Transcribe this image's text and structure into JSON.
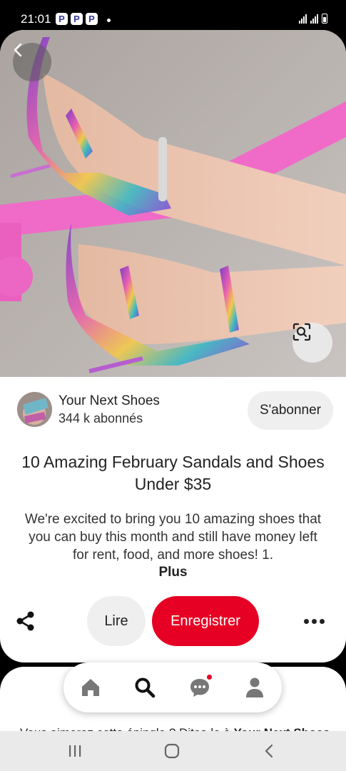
{
  "status_bar": {
    "time": "21:01",
    "app_badges": [
      "P",
      "P",
      "P"
    ]
  },
  "pin": {
    "image_description_icon": "sandals-photo",
    "creator": {
      "name": "Your Next Shoes",
      "followers": "344 k abonnés"
    },
    "follow_label": "S'abonner",
    "title": "10 Amazing February Sandals and Shoes Under $35",
    "description": "We're excited to bring you 10 amazing shoes that you can buy this month and still have money left for rent, food, and more shoes! 1.",
    "more_label": "Plus",
    "actions": {
      "read_label": "Lire",
      "save_label": "Enregistrer"
    }
  },
  "next_card": {
    "text_prefix": "Vous aimerez cette épingle ? Dites-le à ",
    "text_bold": "Your Next Shoes"
  },
  "colors": {
    "accent": "#e60023",
    "button_gray": "#efefef",
    "text": "#222222"
  },
  "icons": {
    "back": "chevron-left-icon",
    "lens": "visual-search-icon",
    "share": "share-icon",
    "more": "more-horizontal-icon",
    "home": "home-icon",
    "search": "search-icon",
    "messages": "chat-bubble-icon",
    "profile": "profile-icon"
  }
}
